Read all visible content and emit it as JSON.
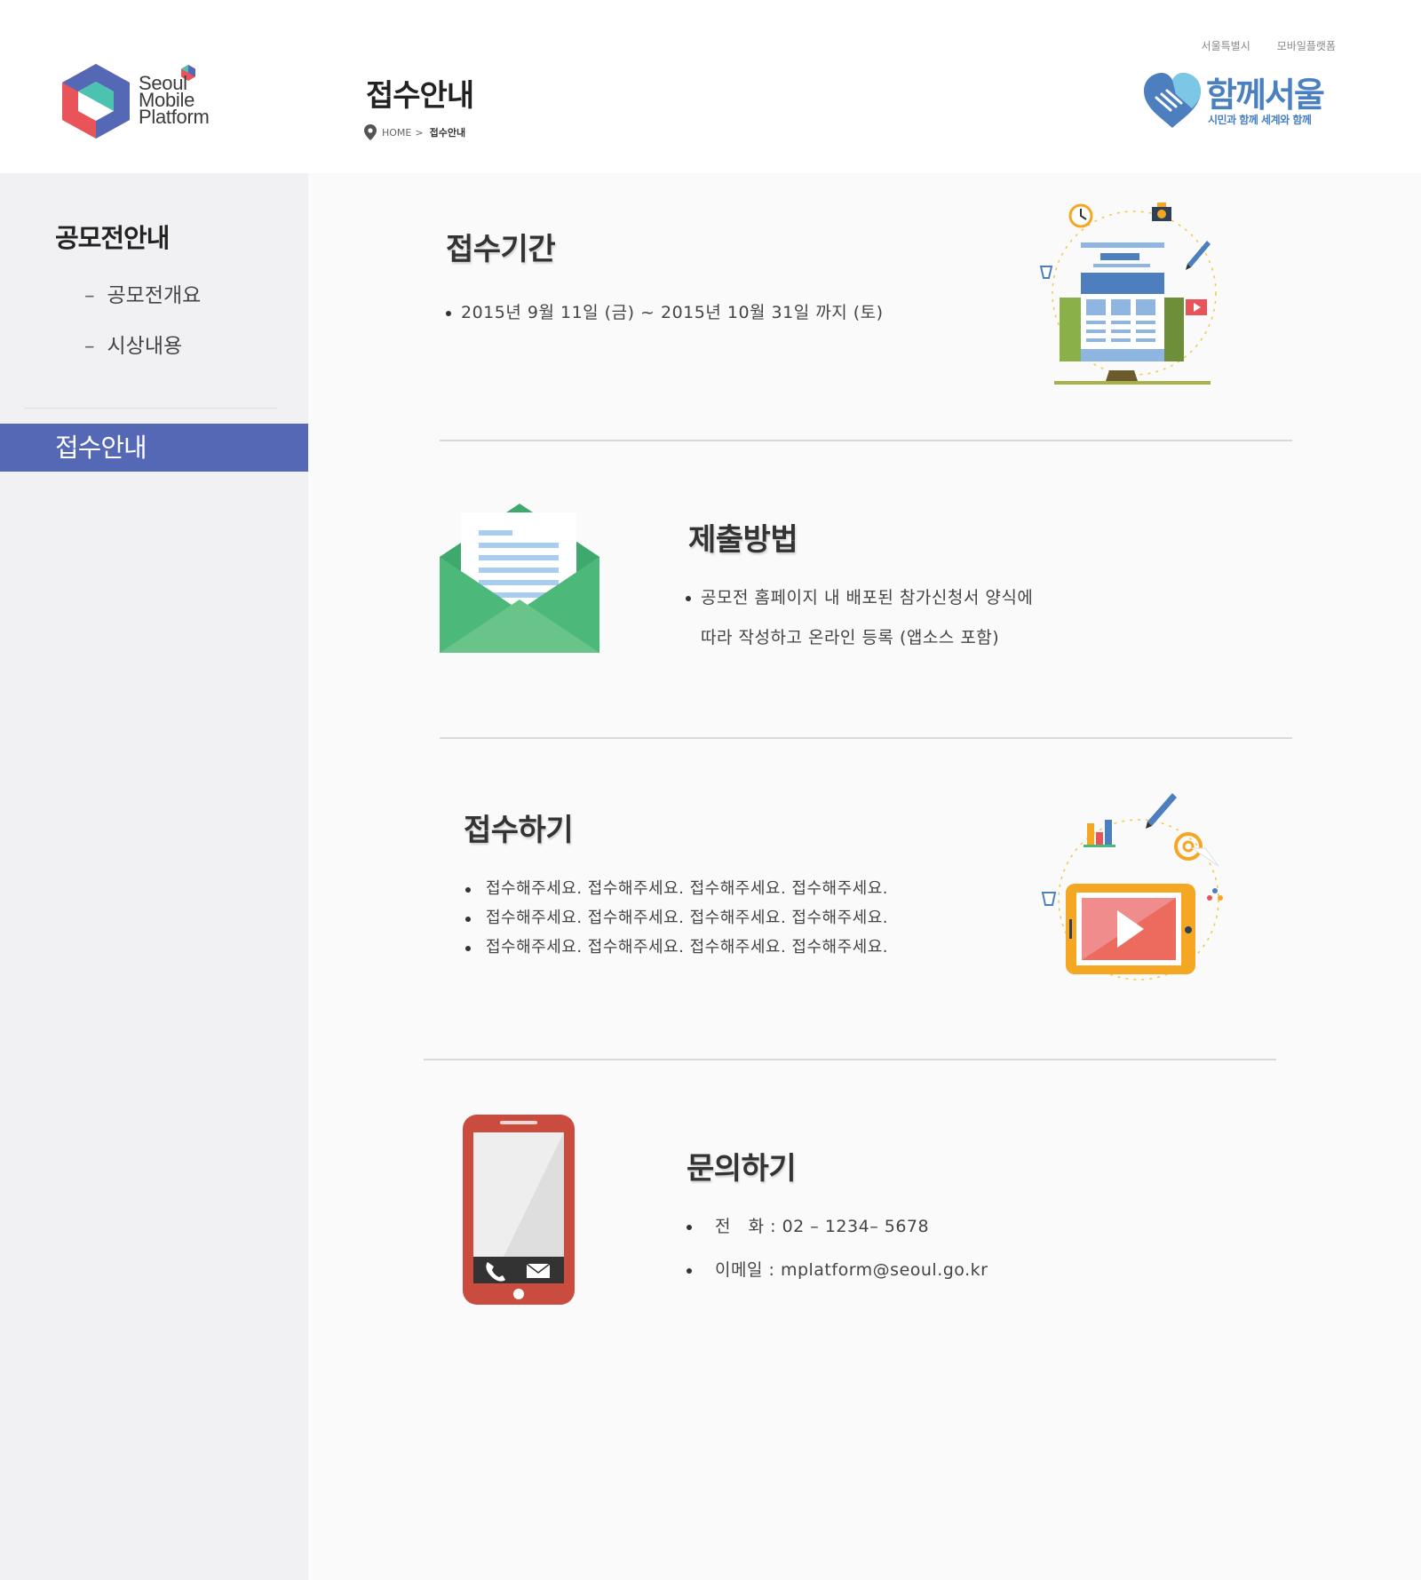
{
  "header": {
    "logo_text": [
      "Seoul",
      "Mobile",
      "Platform"
    ],
    "page_title": "접수안내",
    "breadcrumb": {
      "home": "HOME",
      "separator": ">",
      "current": "접수안내"
    },
    "top_links": [
      "서울특별시",
      "모바일플랫폼"
    ],
    "brand": {
      "title": "함께서울",
      "subtitle": "시민과 함께 세계와 함께"
    }
  },
  "sidebar": {
    "title": "공모전안내",
    "items": [
      {
        "dash": "–",
        "label": "공모전개요"
      },
      {
        "dash": "–",
        "label": "시상내용"
      }
    ],
    "active": "접수안내"
  },
  "sections": {
    "period": {
      "title": "접수기간",
      "text": "2015년 9월 11일 (금) ~ 2015년 10월 31일 까지 (토)"
    },
    "method": {
      "title": "제출방법",
      "line1": "공모전 홈페이지 내 배포된 참가신청서 양식에",
      "line2": "따라 작성하고 온라인 등록 (앱소스 포함)"
    },
    "apply": {
      "title": "접수하기",
      "lines": [
        "접수해주세요. 접수해주세요. 접수해주세요. 접수해주세요.",
        "접수해주세요. 접수해주세요. 접수해주세요. 접수해주세요.",
        "접수해주세요. 접수해주세요. 접수해주세요. 접수해주세요."
      ]
    },
    "contact": {
      "title": "문의하기",
      "phone_label": "전   화 :",
      "phone": "02 – 1234– 5678",
      "email_label": "이메일 :",
      "email": "mplatform@seoul.go.kr"
    }
  },
  "colors": {
    "accent": "#5468b5",
    "brand_blue": "#4a7fc0",
    "envelope_green": "#4cb87a",
    "phone_red": "#c94c3f",
    "tablet_orange": "#f5a623"
  },
  "icons": [
    "location-pin-icon",
    "phone-call-icon",
    "mail-icon",
    "play-icon",
    "clock-icon",
    "camera-icon",
    "pencil-icon"
  ]
}
